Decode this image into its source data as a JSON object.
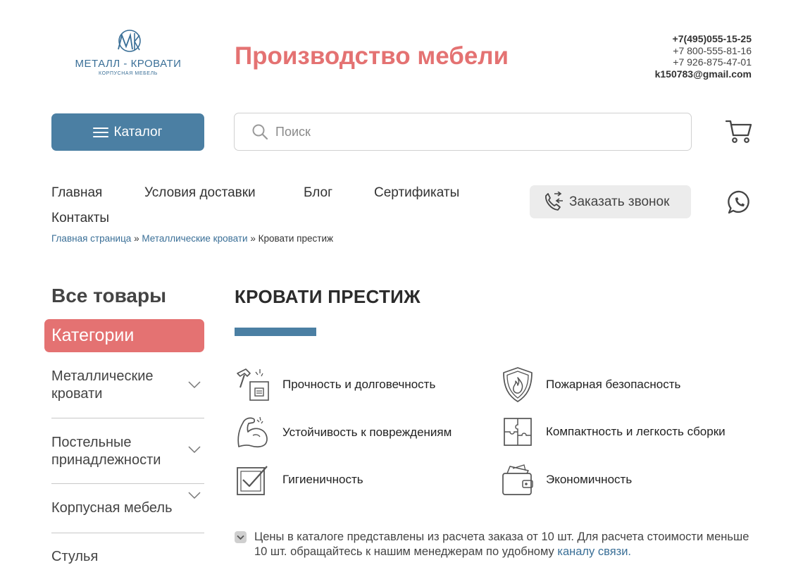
{
  "header": {
    "logo": {
      "monogram": "MK",
      "name": "МЕТАЛЛ - КРОВАТИ",
      "subtitle": "КОРПУСНАЯ МЕБЕЛЬ"
    },
    "site_title": "Производство мебели",
    "contacts": {
      "phone_main": "+7(495)055-15-25",
      "phone_2": "+7 800-555-81-16",
      "phone_3": "+7 926-875-47-01",
      "email": "k150783@gmail.com"
    }
  },
  "toolbar": {
    "catalog_label": "Каталог",
    "search_placeholder": "Поиск",
    "cart_icon": "cart-icon"
  },
  "nav": {
    "items": [
      {
        "label": "Главная"
      },
      {
        "label": "Условия доставки"
      },
      {
        "label": "Блог"
      },
      {
        "label": "Сертификаты"
      },
      {
        "label": "Контакты"
      }
    ],
    "call_label": "Заказать звонок",
    "whatsapp_icon": "whatsapp-icon"
  },
  "breadcrumb": {
    "items": [
      "Главная страница",
      "Металлические кровати"
    ],
    "separator": "»",
    "current": "Кровати престиж"
  },
  "sidebar": {
    "heading": "Все товары",
    "categories_label": "Категории",
    "items": [
      {
        "label": "Металлические кровати",
        "icon": "chevron-down-icon"
      },
      {
        "label": "Постельные принадлежности",
        "icon": "chevron-down-icon"
      },
      {
        "label": "Корпусная мебель",
        "icon": "chevron-down-icon"
      },
      {
        "label": "Стулья"
      }
    ]
  },
  "main": {
    "title": "КРОВАТИ ПРЕСТИЖ",
    "accent_color": "#4b7fa3",
    "features": [
      {
        "label": "Прочность и долговечность",
        "icon": "hammer-icon"
      },
      {
        "label": "Пожарная безопасность",
        "icon": "fire-shield-icon"
      },
      {
        "label": "Устойчивость к повреждениям",
        "icon": "bicep-icon"
      },
      {
        "label": "Компактность и легкость сборки",
        "icon": "puzzle-icon"
      },
      {
        "label": "Гигиеничность",
        "icon": "checkbox-icon"
      },
      {
        "label": "Экономичность",
        "icon": "wallet-icon"
      }
    ],
    "note": {
      "text": "Цены в каталоге представлены из расчета заказа от 10 шт. Для расчета стоимости меньше 10 шт. обращайтесь к нашим менеджерам по удобному",
      "link": "каналу связи."
    }
  },
  "colors": {
    "brand_red": "#e47272",
    "brand_blue": "#4b7fa3",
    "link_blue": "#3a6f97"
  }
}
